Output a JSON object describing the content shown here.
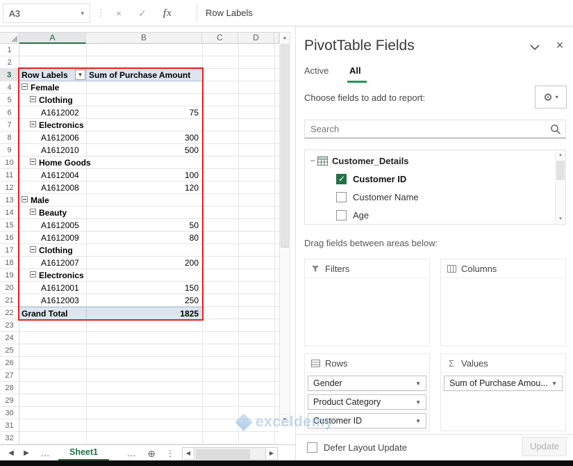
{
  "formula_bar": {
    "name_box": "A3",
    "fx_label": "fx",
    "formula": "Row Labels"
  },
  "grid": {
    "columns": [
      "A",
      "B",
      "C",
      "D"
    ],
    "row_count": 32,
    "selected_column": "A",
    "selected_row": 3
  },
  "pivot": {
    "rows": [
      {
        "row": 3,
        "type": "header",
        "a": "Row Labels",
        "b": "Sum of Purchase Amount"
      },
      {
        "row": 4,
        "type": "group",
        "a": "Female"
      },
      {
        "row": 5,
        "type": "category",
        "a": "Clothing"
      },
      {
        "row": 6,
        "type": "item",
        "a": "A1612002",
        "b": 75
      },
      {
        "row": 7,
        "type": "category",
        "a": "Electronics"
      },
      {
        "row": 8,
        "type": "item",
        "a": "A1612006",
        "b": 300
      },
      {
        "row": 9,
        "type": "item",
        "a": "A1612010",
        "b": 500
      },
      {
        "row": 10,
        "type": "category",
        "a": "Home Goods"
      },
      {
        "row": 11,
        "type": "item",
        "a": "A1612004",
        "b": 100
      },
      {
        "row": 12,
        "type": "item",
        "a": "A1612008",
        "b": 120
      },
      {
        "row": 13,
        "type": "group",
        "a": "Male"
      },
      {
        "row": 14,
        "type": "category",
        "a": "Beauty"
      },
      {
        "row": 15,
        "type": "item",
        "a": "A1612005",
        "b": 50
      },
      {
        "row": 16,
        "type": "item",
        "a": "A1612009",
        "b": 80
      },
      {
        "row": 17,
        "type": "category",
        "a": "Clothing"
      },
      {
        "row": 18,
        "type": "item",
        "a": "A1612007",
        "b": 200
      },
      {
        "row": 19,
        "type": "category",
        "a": "Electronics"
      },
      {
        "row": 20,
        "type": "item",
        "a": "A1612001",
        "b": 150
      },
      {
        "row": 21,
        "type": "item",
        "a": "A1612003",
        "b": 250
      },
      {
        "row": 22,
        "type": "grand",
        "a": "Grand Total",
        "b": 1825
      }
    ]
  },
  "pane": {
    "title": "PivotTable Fields",
    "tab_active": "Active",
    "tab_all": "All",
    "choose_label": "Choose fields to add to report:",
    "search_placeholder": "Search",
    "table_name": "Customer_Details",
    "fields": [
      {
        "label": "Customer ID",
        "checked": true
      },
      {
        "label": "Customer Name",
        "checked": false
      },
      {
        "label": "Age",
        "checked": false
      }
    ],
    "drag_label": "Drag fields between areas below:",
    "areas": {
      "filters_label": "Filters",
      "columns_label": "Columns",
      "rows_label": "Rows",
      "values_label": "Values",
      "rows_items": [
        "Gender",
        "Product Category",
        "Customer ID"
      ],
      "values_items": [
        "Sum of Purchase Amou..."
      ]
    },
    "defer_label": "Defer Layout Update",
    "update_label": "Update"
  },
  "sheet_tabs": {
    "active_sheet": "Sheet1"
  },
  "watermark": {
    "text": "exceldemy"
  },
  "colors": {
    "accent_green": "#217346",
    "selection_red": "#ee1c1c",
    "pivot_header_bg": "#dde6f0"
  }
}
